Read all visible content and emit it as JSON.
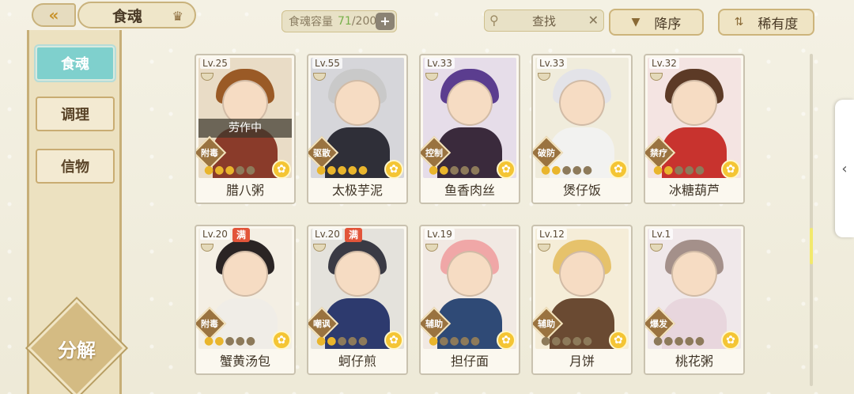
{
  "header": {
    "back_icon": "double-chevron-left-icon",
    "title": "食魂",
    "home_icon": "crown-icon",
    "capacity_label": "食魂容量",
    "capacity_current": "71",
    "capacity_total": "/200",
    "capacity_plus": "+",
    "search_label": "查找",
    "search_clear": "✕",
    "sort_order_label": "降序",
    "sort_by_label": "稀有度"
  },
  "sidebar": {
    "items": [
      {
        "label": "食魂",
        "active": true
      },
      {
        "label": "调理",
        "active": false
      },
      {
        "label": "信物",
        "active": false
      }
    ],
    "decompose_label": "分解"
  },
  "cards": [
    {
      "level": "Lv.25",
      "name": "腊八粥",
      "role": "附毒",
      "status": "劳作中",
      "full": "",
      "stars_on": 3,
      "hair": "#9a5a26",
      "body": "#8a3b2a",
      "bg": "#e9dcc6"
    },
    {
      "level": "Lv.55",
      "name": "太极芋泥",
      "role": "驱散",
      "status": "",
      "full": "",
      "stars_on": 5,
      "hair": "#c9c9c9",
      "body": "#2f2f38",
      "bg": "#d6d6da"
    },
    {
      "level": "Lv.33",
      "name": "鱼香肉丝",
      "role": "控制",
      "status": "",
      "full": "",
      "stars_on": 2,
      "hair": "#5b3d8f",
      "body": "#3a2a3c",
      "bg": "#e6dde9"
    },
    {
      "level": "Lv.33",
      "name": "煲仔饭",
      "role": "破防",
      "status": "",
      "full": "",
      "stars_on": 2,
      "hair": "#e3e3e8",
      "body": "#f2f2f0",
      "bg": "#f0ecdc"
    },
    {
      "level": "Lv.32",
      "name": "冰糖葫芦",
      "role": "禁疗",
      "status": "",
      "full": "",
      "stars_on": 2,
      "hair": "#5c3a26",
      "body": "#c8332e",
      "bg": "#f4e4e2"
    },
    {
      "level": "Lv.20",
      "name": "蟹黄汤包",
      "role": "附毒",
      "status": "",
      "full": "满",
      "stars_on": 2,
      "hair": "#2a2424",
      "body": "#f0ede7",
      "bg": "#f4efe4"
    },
    {
      "level": "Lv.20",
      "name": "蚵仔煎",
      "role": "嘲讽",
      "status": "",
      "full": "满",
      "stars_on": 2,
      "hair": "#3a3a44",
      "body": "#2d3a6e",
      "bg": "#e4e2dc"
    },
    {
      "level": "Lv.19",
      "name": "担仔面",
      "role": "辅助",
      "status": "",
      "full": "",
      "stars_on": 1,
      "hair": "#f0a7a7",
      "body": "#2f4a76",
      "bg": "#f1e9e3"
    },
    {
      "level": "Lv.12",
      "name": "月饼",
      "role": "辅助",
      "status": "",
      "full": "",
      "stars_on": 0,
      "hair": "#e6c26b",
      "body": "#6a4a32",
      "bg": "#f5edd8"
    },
    {
      "level": "Lv.1",
      "name": "桃花粥",
      "role": "爆发",
      "status": "",
      "full": "",
      "stars_on": 0,
      "hair": "#a4908a",
      "body": "#e8d6dd",
      "bg": "#f0e8ea"
    }
  ],
  "colors": {
    "accent_teal": "#7fd0cd",
    "star_gold": "#e9b52c",
    "full_badge": "#e2553a",
    "capacity_value": "#77b04a"
  }
}
